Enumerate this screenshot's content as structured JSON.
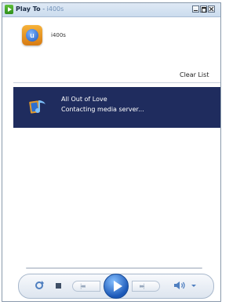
{
  "window": {
    "title_app": "Play To",
    "title_sep": " - ",
    "title_device": "i400s",
    "minimize_label": "Minimize",
    "maximize_label": "Maximize",
    "close_label": "Close"
  },
  "device": {
    "name": "i400s",
    "icon_letter": "u"
  },
  "toolbar": {
    "clear_list_label": "Clear List"
  },
  "playlist": {
    "items": [
      {
        "title": "All Out of Love",
        "status": "Contacting media server...",
        "icon": "music-note-icon",
        "selected": true
      }
    ]
  },
  "controls": {
    "prev_glyph": "|◂◂◂",
    "next_glyph": "▸▸▸|",
    "icons": {
      "shuffle": "shuffle-icon",
      "stop": "stop-icon",
      "previous": "previous-icon",
      "play": "play-icon",
      "next": "next-icon",
      "volume": "speaker-icon"
    }
  },
  "colors": {
    "selection": "#1f2c5e",
    "accent": "#1b58b8",
    "titlebar": "#dfe9f5"
  }
}
